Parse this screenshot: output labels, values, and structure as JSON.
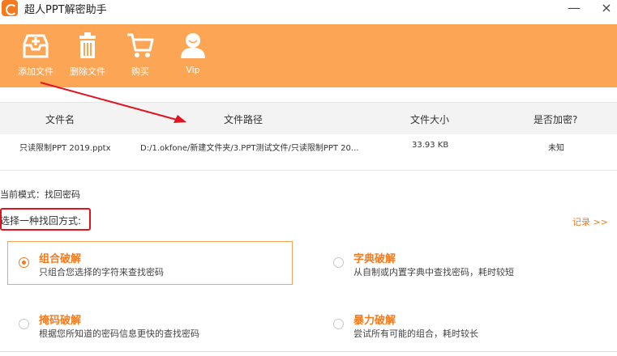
{
  "window": {
    "title": "超人PPT解密助手",
    "minimize_symbol": "—",
    "close_symbol": "×",
    "accent": "#f47a1f",
    "toolbar_bg": "#fca555"
  },
  "toolbar": {
    "items": [
      {
        "label": "添加文件",
        "icon": "add-file-icon"
      },
      {
        "label": "删除文件",
        "icon": "trash-icon"
      },
      {
        "label": "购买",
        "icon": "cart-icon"
      },
      {
        "label": "Vip",
        "icon": "user-icon"
      }
    ]
  },
  "table": {
    "headers": [
      "文件名",
      "文件路径",
      "文件大小",
      "是否加密?"
    ],
    "rows": [
      {
        "name": "只读限制PPT 2019.pptx",
        "path": "D:/1.okfone/新建文件夹/3.PPT测试文件/只读限制PPT 20...",
        "size": "33.93 KB",
        "encrypted": "未知"
      }
    ]
  },
  "mode": {
    "label": "当前模式：找回密码"
  },
  "recovery": {
    "choose_label": "选择一种找回方式:",
    "record_link": "记录 >>",
    "options": [
      {
        "title": "组合破解",
        "desc": "只组合您选择的字符来查找密码",
        "selected": true
      },
      {
        "title": "字典破解",
        "desc": "从自制或内置字典中查找密码，耗时较短",
        "selected": false
      },
      {
        "title": "掩码破解",
        "desc": "根据您所知道的密码信息更快的查找密码",
        "selected": false
      },
      {
        "title": "暴力破解",
        "desc": "尝试所有可能的组合，耗时较长",
        "selected": false
      }
    ]
  },
  "annotation": {
    "highlight_color": "#e0141e"
  }
}
